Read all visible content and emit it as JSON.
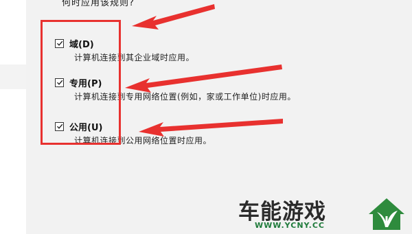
{
  "header": {
    "text": "何时应用该规则?"
  },
  "options": [
    {
      "label": "域(D)",
      "description": "计算机连接到其企业域时应用。",
      "checked": true
    },
    {
      "label": "专用(P)",
      "description": "计算机连接到专用网络位置(例如，家或工作单位)时应用。",
      "checked": true
    },
    {
      "label": "公用(U)",
      "description": "计算机连接到公用网络位置时应用。",
      "checked": true
    }
  ],
  "annotation": {
    "color": "#e8312f"
  },
  "watermark": {
    "text": "车能游戏",
    "url": "WWW.YCNY.CC",
    "logo": "leaf-logo-icon"
  }
}
